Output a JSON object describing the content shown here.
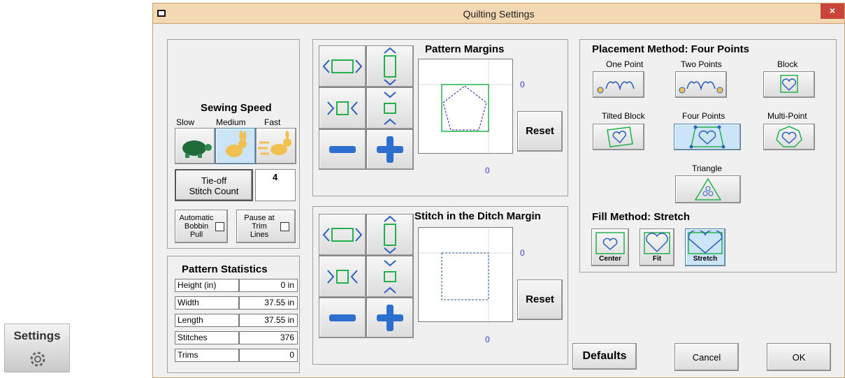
{
  "settings_widget": {
    "label": "Settings",
    "icon": "gear-icon"
  },
  "window": {
    "title": "Quilting Settings",
    "close_label": "×"
  },
  "sewing_speed": {
    "title": "Sewing Speed",
    "options": [
      "Slow",
      "Medium",
      "Fast"
    ],
    "selected": "Medium",
    "tie_off_label_line1": "Tie-off",
    "tie_off_label_line2": "Stitch Count",
    "tie_off_value": "4",
    "auto_bobbin": {
      "line1": "Automatic",
      "line2": "Bobbin",
      "line3": "Pull"
    },
    "pause_trim": {
      "line1": "Pause at",
      "line2": "Trim",
      "line3": "Lines"
    }
  },
  "pattern_statistics": {
    "title": "Pattern Statistics",
    "rows": [
      {
        "label": "Height (in)",
        "value": "0 in"
      },
      {
        "label": "Width",
        "value": "37.55 in"
      },
      {
        "label": "Length",
        "value": "37.55 in"
      },
      {
        "label": "Stitches",
        "value": "376"
      },
      {
        "label": "Trims",
        "value": "0"
      }
    ]
  },
  "pattern_margins": {
    "title": "Pattern Margins",
    "reset_label": "Reset",
    "axis_right": "0",
    "axis_bottom": "0"
  },
  "ditch_margin": {
    "title": "Stitch in the Ditch Margin",
    "reset_label": "Reset",
    "axis_right": "0",
    "axis_bottom": "0"
  },
  "placement": {
    "title": "Placement Method: Four Points",
    "options": [
      {
        "label": "One Point"
      },
      {
        "label": "Two Points"
      },
      {
        "label": "Block"
      },
      {
        "label": "Tilted Block"
      },
      {
        "label": "Four Points"
      },
      {
        "label": "Multi-Point"
      },
      {
        "label": "Triangle"
      }
    ],
    "selected": "Four Points"
  },
  "fill": {
    "title": "Fill Method: Stretch",
    "options": [
      "Center",
      "Fit",
      "Stretch"
    ],
    "selected": "Stretch"
  },
  "footer": {
    "defaults_label": "Defaults",
    "cancel_label": "Cancel",
    "ok_label": "OK"
  },
  "colors": {
    "green": "#22b14c",
    "blue": "#3b3bd6",
    "title_bg": "#f3d8b4",
    "close_bg": "#c8453b",
    "selected_bg": "#cce4f7"
  }
}
